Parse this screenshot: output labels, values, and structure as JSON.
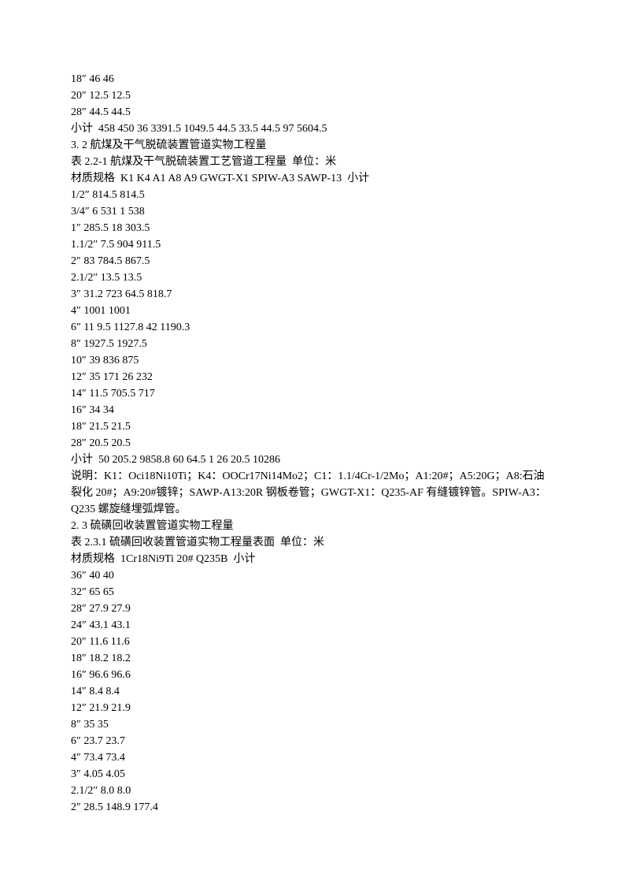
{
  "lines": [
    "18″ 46 46",
    "20″ 12.5 12.5",
    "28″ 44.5 44.5",
    "小计  458 450 36 3391.5 1049.5 44.5 33.5 44.5 97 5604.5",
    "3. 2 航煤及干气脱硫装置管道实物工程量",
    "表 2.2-1 航煤及干气脱硫装置工艺管道工程量  单位：米",
    "材质规格  K1 K4 A1 A8 A9 GWGT-X1 SPIW-A3 SAWP-13  小计",
    "1/2″ 814.5 814.5",
    "3/4″ 6 531 1 538",
    "1″ 285.5 18 303.5",
    "1.1/2″ 7.5 904 911.5",
    "2″ 83 784.5 867.5",
    "2.1/2″ 13.5 13.5",
    "3″ 31.2 723 64.5 818.7",
    "4″ 1001 1001",
    "6″ 11 9.5 1127.8 42 1190.3",
    "8″ 1927.5 1927.5",
    "10″ 39 836 875",
    "12″ 35 171 26 232",
    "14″ 11.5 705.5 717",
    "16″ 34 34",
    "18″ 21.5 21.5",
    "28″ 20.5 20.5",
    "小计  50 205.2 9858.8 60 64.5 1 26 20.5 10286",
    "说明：K1：Oci18Ni10Ti；K4：OOCr17Ni14Mo2；C1：1.1/4Cr-1/2Mo；A1:20#；A5:20G；A8:石油裂化 20#；A9:20#镀锌；SAWP-A13:20R 钢板卷管；GWGT-X1：Q235-AF 有缝镀锌管。SPIW-A3：Q235 螺旋缝埋弧焊管。",
    "2. 3 硫磺回收装置管道实物工程量",
    "表 2.3.1 硫磺回收装置管道实物工程量表面  单位：米",
    "材质规格  1Cr18Ni9Ti 20# Q235B  小计",
    "36″ 40 40",
    "32″ 65 65",
    "28″ 27.9 27.9",
    "24″ 43.1 43.1",
    "20″ 11.6 11.6",
    "18″ 18.2 18.2",
    "16″ 96.6 96.6",
    "14″ 8.4 8.4",
    "12″ 21.9 21.9",
    "8″ 35 35",
    "6″ 23.7 23.7",
    "4″ 73.4 73.4",
    "3″ 4.05 4.05",
    "2.1/2″ 8.0 8.0",
    "2″ 28.5 148.9 177.4"
  ]
}
